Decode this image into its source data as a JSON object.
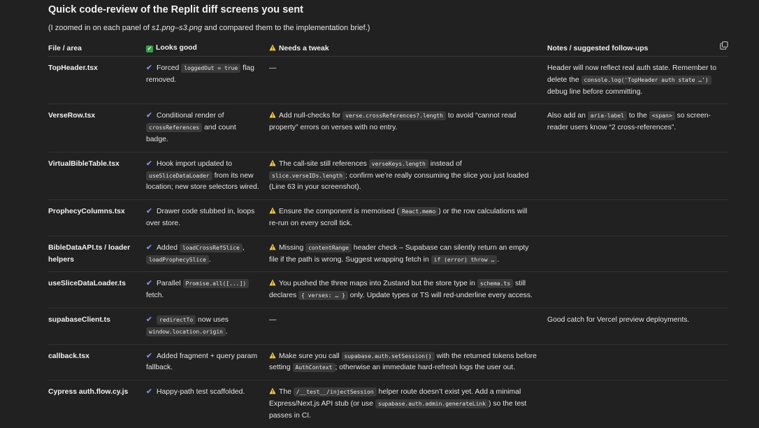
{
  "title": "Quick code-review of the Replit diff screens you sent",
  "subtitle": {
    "pre": "(I zoomed in on each panel of ",
    "files": "s1.png–s3.png",
    "post": " and compared them to the implementation brief.)"
  },
  "headers": {
    "file": "File / area",
    "good": "Looks good",
    "tweak": "Needs a tweak",
    "notes": "Notes / suggested follow-ups"
  },
  "rows": [
    {
      "file": "TopHeader.tsx",
      "good": [
        {
          "t": "Forced "
        },
        {
          "c": "loggedOut = true"
        },
        {
          "t": " flag removed."
        }
      ],
      "tweak": [
        {
          "t": "—"
        }
      ],
      "tweak_warn": false,
      "notes": [
        {
          "t": "Header will now reflect real auth state. Remember to delete the "
        },
        {
          "c": "console.log('TopHeader auth state …')"
        },
        {
          "t": " debug line before committing."
        }
      ]
    },
    {
      "file": "VerseRow.tsx",
      "good": [
        {
          "t": "Conditional render of "
        },
        {
          "c": "crossReferences"
        },
        {
          "t": " and count badge."
        }
      ],
      "tweak": [
        {
          "t": "Add null-checks for "
        },
        {
          "c": "verse.crossReferences?.length"
        },
        {
          "t": " to avoid “cannot read property” errors on verses with no entry."
        }
      ],
      "tweak_warn": true,
      "notes": [
        {
          "t": "Also add an "
        },
        {
          "c": "aria-label"
        },
        {
          "t": " to the "
        },
        {
          "c": "<span>"
        },
        {
          "t": " so screen-reader users know “2 cross-references”."
        }
      ]
    },
    {
      "file": "VirtualBibleTable.tsx",
      "good": [
        {
          "t": "Hook import updated to "
        },
        {
          "c": "useSliceDataLoader"
        },
        {
          "t": " from its new location; new store selectors wired."
        }
      ],
      "tweak": [
        {
          "t": "The call-site still references "
        },
        {
          "c": "verseKeys.length"
        },
        {
          "t": " instead of "
        },
        {
          "c": "slice.verseIDs.length"
        },
        {
          "t": "; confirm we’re really consuming the slice you just loaded (Line 63 in your screenshot)."
        }
      ],
      "tweak_warn": true,
      "notes": []
    },
    {
      "file": "ProphecyColumns.tsx",
      "good": [
        {
          "t": "Drawer code stubbed in, loops over store."
        }
      ],
      "tweak": [
        {
          "t": "Ensure the component is memoised ("
        },
        {
          "c": "React.memo"
        },
        {
          "t": ") or the row calculations will re-run on every scroll tick."
        }
      ],
      "tweak_warn": true,
      "notes": []
    },
    {
      "file": "BibleDataAPI.ts / loader helpers",
      "good": [
        {
          "t": "Added "
        },
        {
          "c": "loadCrossRefSlice"
        },
        {
          "t": ", "
        },
        {
          "c": "loadProphecySlice"
        },
        {
          "t": "."
        }
      ],
      "tweak": [
        {
          "t": "Missing "
        },
        {
          "c": "contentRange"
        },
        {
          "t": " header check – Supabase can silently return an empty file if the path is wrong. Suggest wrapping fetch in "
        },
        {
          "c": "if (error) throw …"
        },
        {
          "t": "."
        }
      ],
      "tweak_warn": true,
      "notes": []
    },
    {
      "file": "useSliceDataLoader.ts",
      "good": [
        {
          "t": "Parallel "
        },
        {
          "c": "Promise.all([...])"
        },
        {
          "t": " fetch."
        }
      ],
      "tweak": [
        {
          "t": "You pushed the three maps into Zustand but the store type in "
        },
        {
          "c": "schema.ts"
        },
        {
          "t": " still declares "
        },
        {
          "c": "{ verses: … }"
        },
        {
          "t": " only. Update types or TS will red-underline every access."
        }
      ],
      "tweak_warn": true,
      "notes": []
    },
    {
      "file": "supabaseClient.ts",
      "good": [
        {
          "c": "redirectTo"
        },
        {
          "t": " now uses "
        },
        {
          "c": "window.location.origin"
        },
        {
          "t": "."
        }
      ],
      "tweak": [
        {
          "t": "—"
        }
      ],
      "tweak_warn": false,
      "notes": [
        {
          "t": "Good catch for Vercel preview deployments."
        }
      ]
    },
    {
      "file": "callback.tsx",
      "good": [
        {
          "t": "Added fragment + query param fallback."
        }
      ],
      "tweak": [
        {
          "t": "Make sure you call "
        },
        {
          "c": "supabase.auth.setSession()"
        },
        {
          "t": " with the returned tokens before setting "
        },
        {
          "c": "AuthContext"
        },
        {
          "t": "; otherwise an immediate hard-refresh logs the user out."
        }
      ],
      "tweak_warn": true,
      "notes": []
    },
    {
      "file": "Cypress auth.flow.cy.js",
      "good": [
        {
          "t": "Happy-path test scaffolded."
        }
      ],
      "tweak": [
        {
          "t": "The "
        },
        {
          "c": "/__test__/injectSession"
        },
        {
          "t": " helper route doesn’t exist yet. Add a minimal Express/Next.js API stub (or use "
        },
        {
          "c": "supabase.auth.admin.generateLink"
        },
        {
          "t": ") so the test passes in CI."
        }
      ],
      "tweak_warn": true,
      "notes": []
    }
  ],
  "icons": {
    "check": "check-icon",
    "warn": "warning-icon",
    "good_header": "green-check-box-icon",
    "copy": "copy-icon"
  },
  "colors": {
    "background": "#212121",
    "check": "#7b8cde",
    "warning": "#f2c94c",
    "code_bg": "#3a3a3a",
    "good_box": "#3c9b4b"
  }
}
